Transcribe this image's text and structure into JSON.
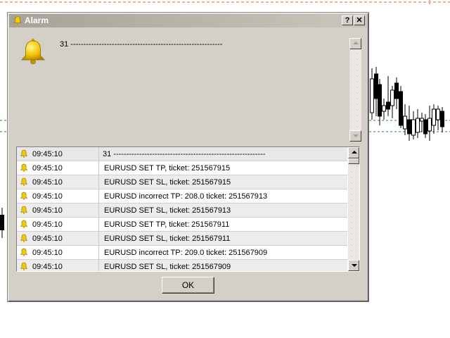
{
  "window": {
    "title": "Alarm",
    "help_label": "?",
    "close_label": "✕"
  },
  "message": {
    "text": "31 -----------------------------------------------------------"
  },
  "log": {
    "rows": [
      {
        "time": "09:45:10",
        "text": "31 -----------------------------------------------------------"
      },
      {
        "time": "09:45:10",
        "text": "EURUSD SET TP, ticket: 251567915"
      },
      {
        "time": "09:45:10",
        "text": "EURUSD SET SL, ticket: 251567915"
      },
      {
        "time": "09:45:10",
        "text": "EURUSD incorrect TP: 208.0 ticket: 251567913"
      },
      {
        "time": "09:45:10",
        "text": "EURUSD SET SL, ticket: 251567913"
      },
      {
        "time": "09:45:10",
        "text": "EURUSD SET TP, ticket: 251567911"
      },
      {
        "time": "09:45:10",
        "text": "EURUSD SET SL, ticket: 251567911"
      },
      {
        "time": "09:45:10",
        "text": "EURUSD incorrect TP: 209.0 ticket: 251567909"
      },
      {
        "time": "09:45:10",
        "text": "EURUSD SET SL, ticket: 251567909"
      }
    ]
  },
  "buttons": {
    "ok_label": "OK"
  },
  "icons": {
    "window": "bell-icon",
    "message": "bell-icon",
    "row": "bell-icon"
  },
  "colors": {
    "bell": "#f5c800",
    "chart_dashes": "#e06040",
    "chart_level": "#2a8a3a"
  }
}
